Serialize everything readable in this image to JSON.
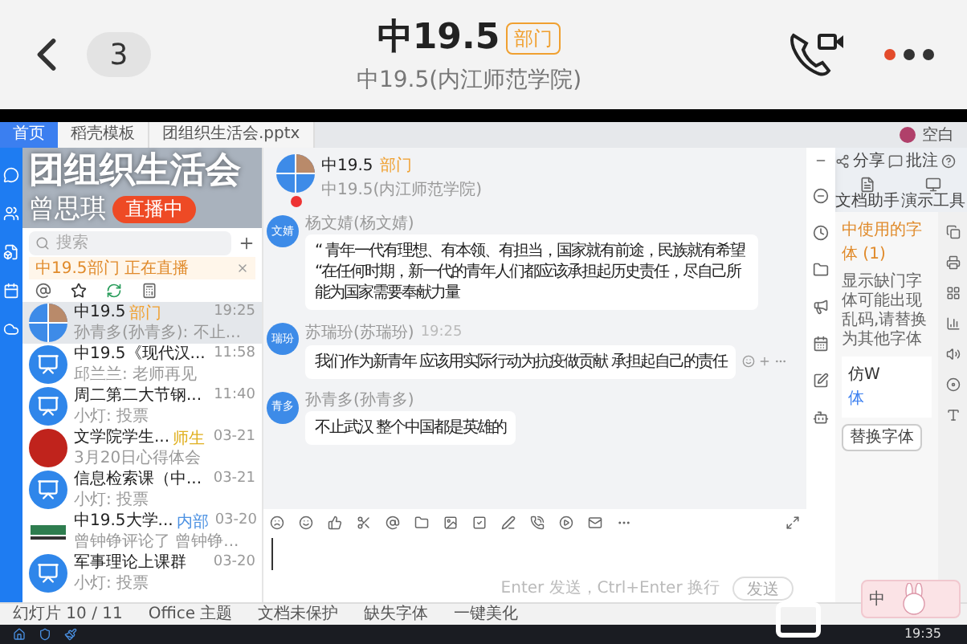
{
  "header": {
    "count": "3",
    "title": "中19.5",
    "badge": "部门",
    "subtitle": "中19.5(内江师范学院)"
  },
  "live_overlay": {
    "title": "团组织生活会",
    "host": "曾思琪",
    "status": "直播中"
  },
  "doc_tabs": [
    {
      "label": "首页",
      "selected": true
    },
    {
      "label": "稻壳模板",
      "selected": false
    },
    {
      "label": "团组织生活会.pptx",
      "selected": false
    }
  ],
  "account": {
    "name": "空白"
  },
  "ribbon": [
    "分享",
    "批注"
  ],
  "ribbon_tools": [
    "文档助手",
    "演示工具"
  ],
  "chat": {
    "search": {
      "placeholder": "搜索"
    },
    "live_banner": "中19.5部门 正在直播",
    "conversations": [
      {
        "kind": "group",
        "name": "中19.5",
        "badge": "部门",
        "color": "#f0a030",
        "time": "19:25",
        "preview": "孙青多(孙青多): 不止...",
        "selected": true
      },
      {
        "kind": "class",
        "name": "中19.5《现代汉...",
        "time": "11:58",
        "preview": "邱兰兰: 老师再见",
        "selected": false
      },
      {
        "kind": "class",
        "name": "周二第二大节钢...",
        "time": "11:40",
        "preview": "小灯: 投票",
        "selected": false
      },
      {
        "kind": "photo",
        "name": "文学院学生...",
        "badge": "师生",
        "color": "#e0b020",
        "time": "03-21",
        "preview": "3月20日心得体会",
        "selected": false
      },
      {
        "kind": "class",
        "name": "信息检索课（中...",
        "time": "03-21",
        "preview": "小灯: 投票",
        "selected": false
      },
      {
        "kind": "logo",
        "name": "中19.5大学...",
        "badge": "内部",
        "color": "#4a90e2",
        "time": "03-20",
        "preview": "曾钟铮评论了 曾钟铮...",
        "selected": false
      },
      {
        "kind": "class",
        "name": "军事理论上课群",
        "time": "03-20",
        "preview": "小灯: 投票",
        "selected": false
      }
    ],
    "header": {
      "name": "中19.5",
      "badge": "部门",
      "subtitle": "中19.5(内江师范学院)"
    },
    "messages": [
      {
        "sender": "杨文婧(杨文婧)",
        "avatar": "文婧",
        "text": "“ 青年一代有理想、有本领、有担当，国家就有前途，民族就有希望 “在任何时期，新一代的青年人们都应该承担起历史责任，尽自己所能为国家需要奉献力量"
      },
      {
        "sender": "苏瑞玢(苏瑞玢)",
        "time": "19:25",
        "avatar": "瑞玢",
        "text": "我们作为新青年 应该用实际行动为抗疫做贡献 承担起自己的责任",
        "hovered": true
      },
      {
        "sender": "孙青多(孙青多)",
        "avatar": "青多",
        "text": "不止武汉 整个中国都是英雄的"
      }
    ],
    "input": {
      "hint": "Enter 发送，Ctrl+Enter 换行",
      "send": "发送"
    }
  },
  "font_panel": {
    "title": "中使用的字体 (1)",
    "description": "显示缺门字体可能出现乱码,请替换为其他字体",
    "font": "仿W",
    "font_note": "体",
    "action": "替换字体"
  },
  "status_bar": [
    "幻灯片 10 / 11",
    "Office 主题",
    "文档未保护",
    "缺失字体",
    "一键美化"
  ],
  "ime": {
    "label": "中"
  },
  "clock": "19:35"
}
